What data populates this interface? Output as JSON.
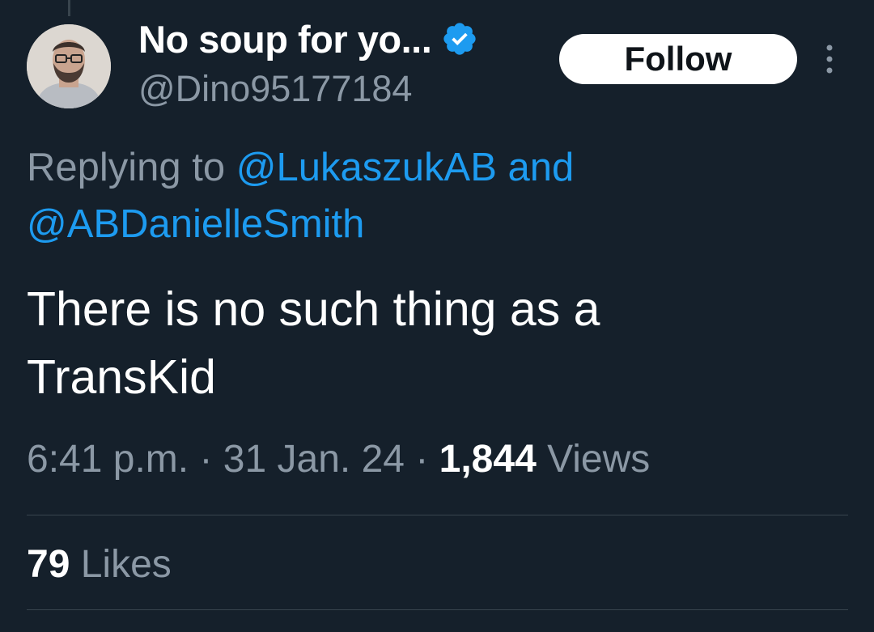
{
  "tweet": {
    "author": {
      "display_name": "No soup for yo...",
      "handle": "@Dino95177184",
      "verified": true
    },
    "follow_label": "Follow",
    "replying_prefix": "Replying to",
    "replying_to": [
      "@LukaszukAB",
      "@ABDanielleSmith"
    ],
    "replying_joiner": "and",
    "text_line1": "There is no such thing as a",
    "text_line2": "TransKid",
    "time": "6:41 p.m.",
    "date": "31 Jan. 24",
    "separator": "·",
    "views_count": "1,844",
    "views_label": "Views",
    "likes_count": "79",
    "likes_label": "Likes"
  },
  "colors": {
    "background": "#15202b",
    "accent": "#1d9bf0",
    "secondary_text": "#8b98a5",
    "primary_text": "#ffffff",
    "divider": "#38444d"
  },
  "icons": {
    "verified": "verified-badge-icon",
    "more": "more-options-icon"
  }
}
